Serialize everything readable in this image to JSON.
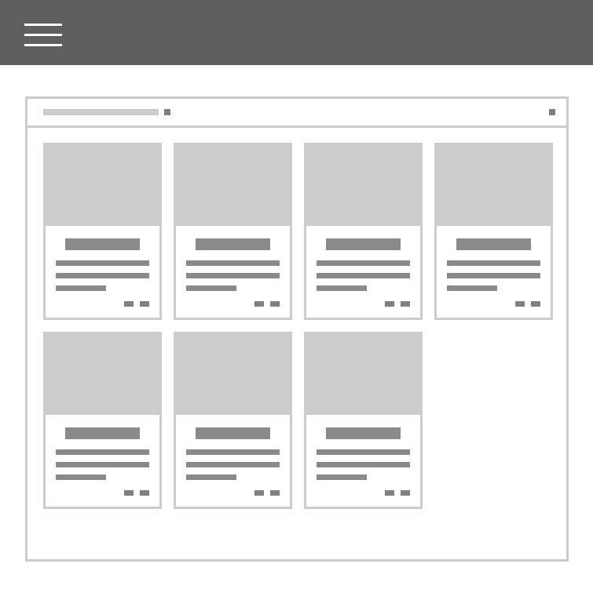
{
  "topbar": {
    "menu_icon": "hamburger-menu-icon",
    "color": "#5f5f5f"
  },
  "panel": {
    "title_placeholder": "",
    "cards": [
      {
        "title": "",
        "lines": [
          "",
          "",
          ""
        ]
      },
      {
        "title": "",
        "lines": [
          "",
          "",
          ""
        ]
      },
      {
        "title": "",
        "lines": [
          "",
          "",
          ""
        ]
      },
      {
        "title": "",
        "lines": [
          "",
          "",
          ""
        ]
      },
      {
        "title": "",
        "lines": [
          "",
          "",
          ""
        ]
      },
      {
        "title": "",
        "lines": [
          "",
          "",
          ""
        ]
      },
      {
        "title": "",
        "lines": [
          "",
          "",
          ""
        ]
      }
    ]
  },
  "colors": {
    "border": "#cccccc",
    "placeholder_dark": "#8a8a8a",
    "image_placeholder": "#cccccc"
  }
}
